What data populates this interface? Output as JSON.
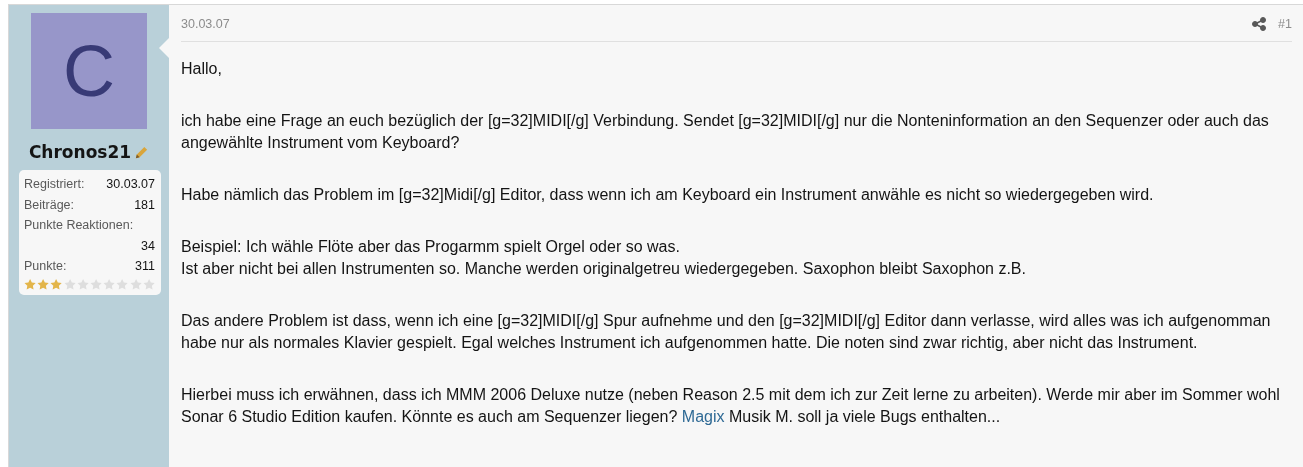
{
  "user": {
    "avatar_letter": "C",
    "name": "Chronos21",
    "stats": [
      {
        "label": "Registriert:",
        "value": "30.03.07"
      },
      {
        "label": "Beiträge:",
        "value": "181"
      },
      {
        "label": "Punkte Reaktionen:",
        "value": "34",
        "wrapped": true
      },
      {
        "label": "Punkte:",
        "value": "311"
      }
    ],
    "stars": 3
  },
  "post": {
    "date": "30.03.07",
    "number": "#1",
    "paragraphs": [
      {
        "lines": [
          [
            {
              "text": "Hallo,"
            }
          ]
        ]
      },
      {
        "lines": [
          [
            {
              "text": "ich habe eine Frage an euch bezüglich der [g=32]MIDI[/g] Verbindung. Sendet [g=32]MIDI[/g] nur die Nonteninformation an den Sequenzer oder auch das angewählte Instrument vom Keyboard?"
            }
          ]
        ]
      },
      {
        "lines": [
          [
            {
              "text": "Habe nämlich das Problem im [g=32]Midi[/g] Editor, dass wenn ich am Keyboard ein Instrument anwähle es nicht so wiedergegeben wird."
            }
          ]
        ]
      },
      {
        "lines": [
          [
            {
              "text": "Beispiel: Ich wähle Flöte aber das Progarmm spielt Orgel oder so was."
            }
          ],
          [
            {
              "text": "Ist aber nicht bei allen Instrumenten so. Manche werden originalgetreu wiedergegeben. Saxophon bleibt Saxophon z.B."
            }
          ]
        ]
      },
      {
        "lines": [
          [
            {
              "text": "Das andere Problem ist dass, wenn ich eine [g=32]MIDI[/g] Spur aufnehme und den [g=32]MIDI[/g] Editor dann verlasse, wird alles was ich aufgenomman habe nur als normales Klavier gespielt. Egal welches Instrument ich aufgenommen hatte. Die noten sind zwar richtig, aber nicht das Instrument."
            }
          ]
        ]
      },
      {
        "lines": [
          [
            {
              "text": "Hierbei muss ich erwähnen, dass ich MMM 2006 Deluxe nutze (neben Reason 2.5 mit dem ich zur Zeit lerne zu arbeiten). Werde mir aber im Sommer wohl Sonar 6 Studio Edition kaufen. Könnte es auch am Sequenzer liegen? "
            },
            {
              "text": "Magix",
              "kind": "link"
            },
            {
              "text": " Musik M. soll ja viele Bugs enthalten..."
            }
          ]
        ]
      }
    ]
  }
}
